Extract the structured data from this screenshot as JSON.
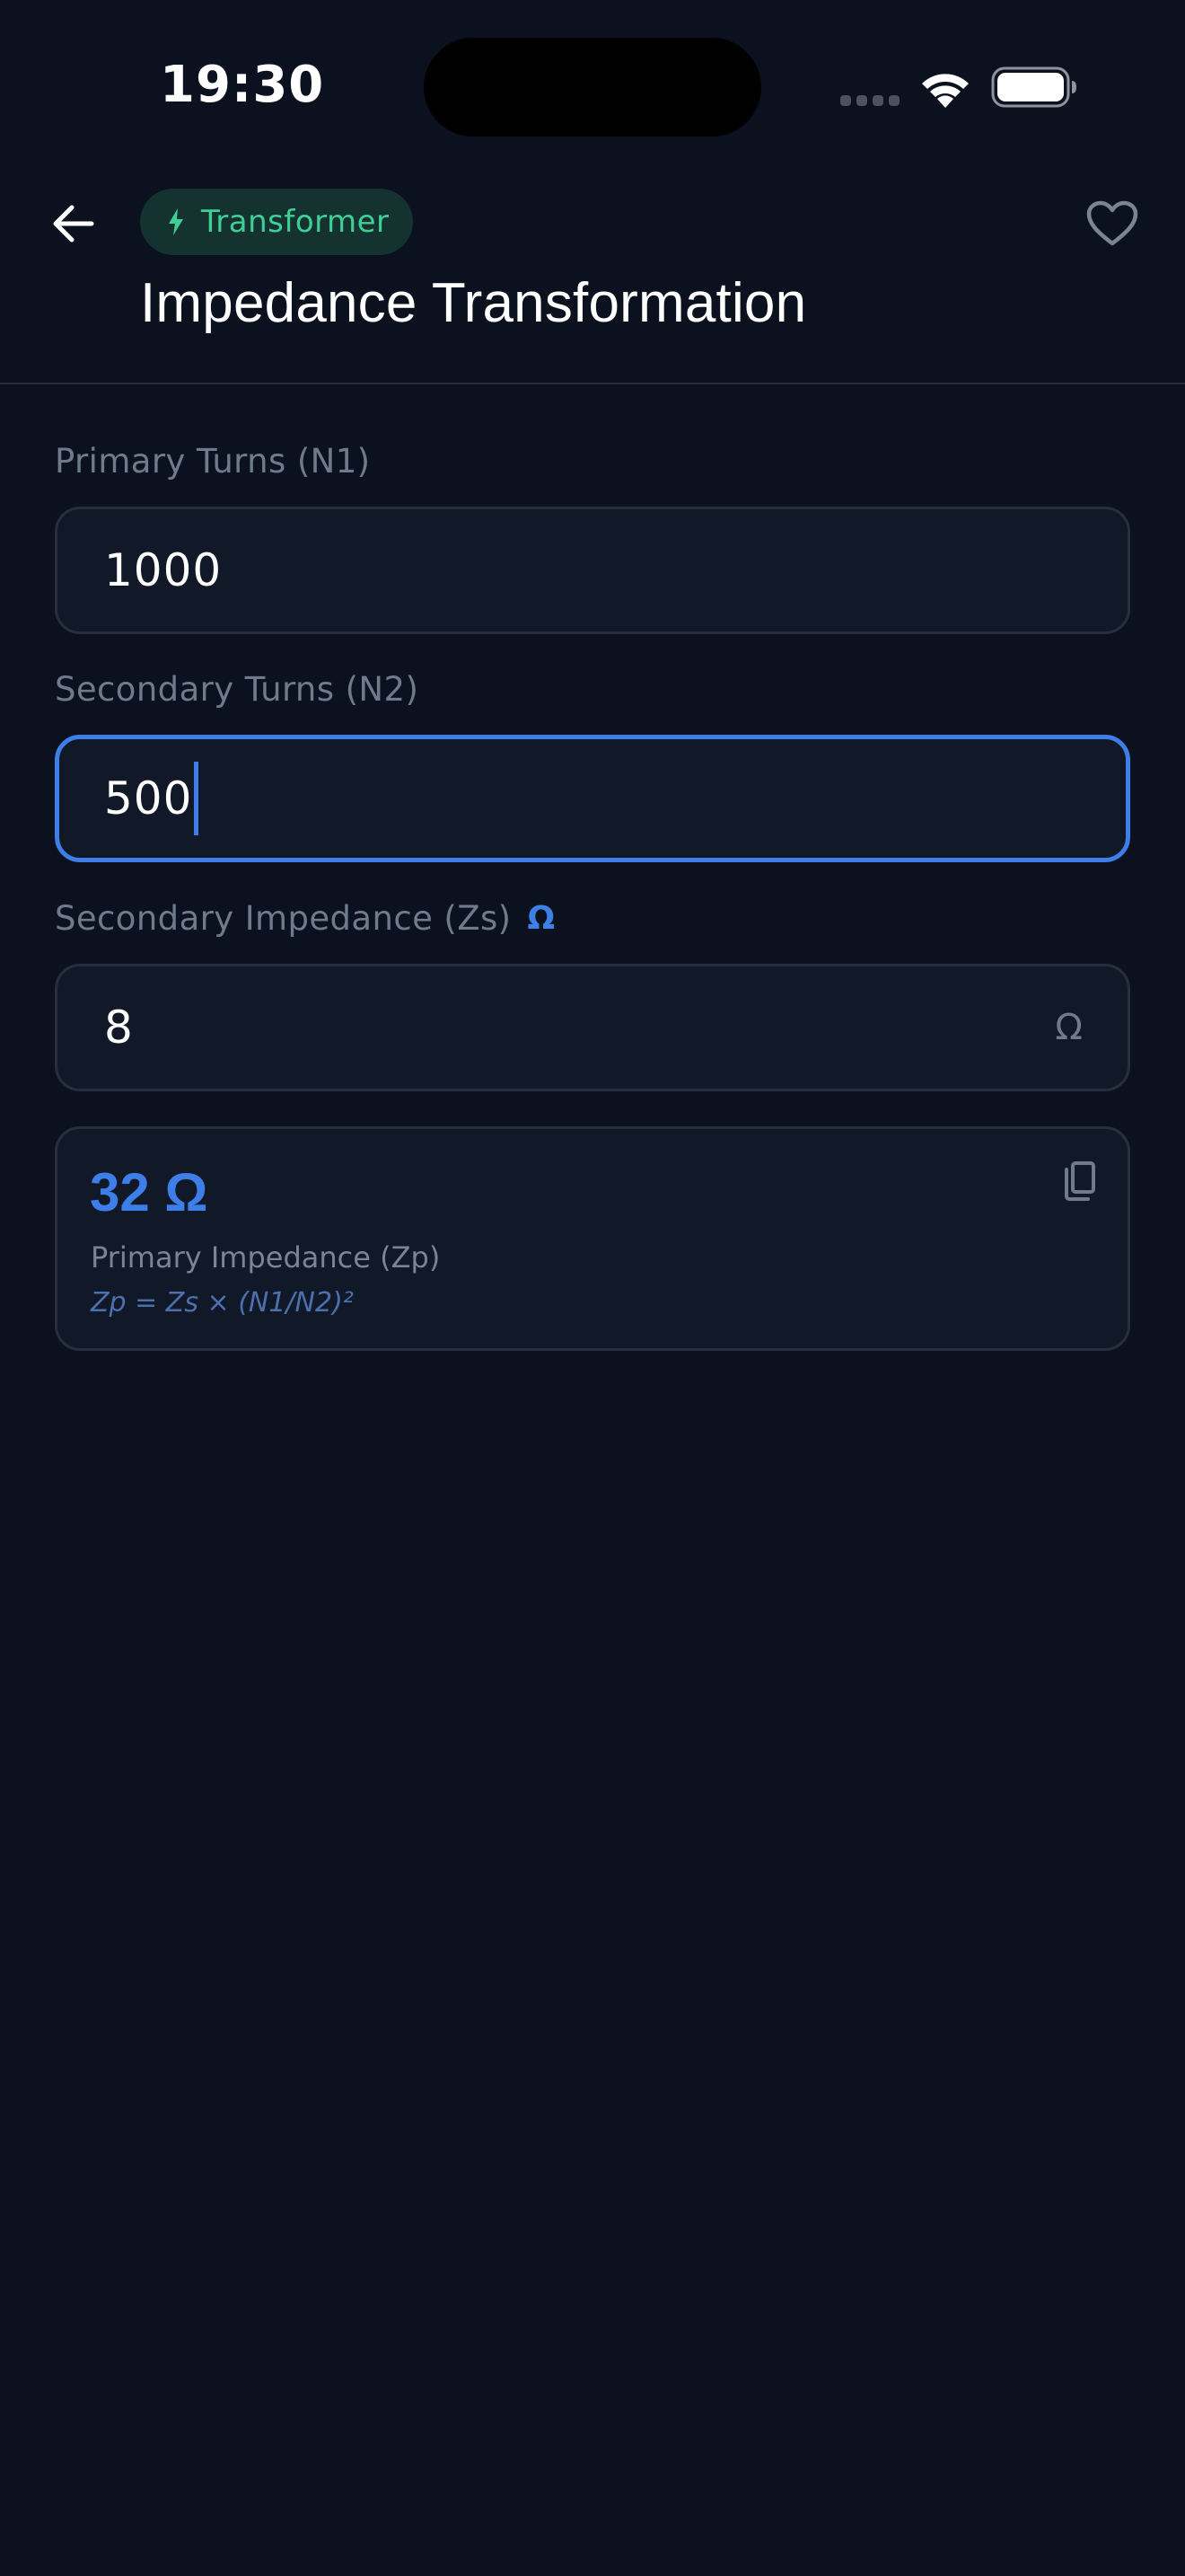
{
  "status_bar": {
    "time": "19:30"
  },
  "header": {
    "category_chip": "Transformer",
    "title": "Impedance Transformation"
  },
  "form": {
    "primary_turns": {
      "label": "Primary Turns (N1)",
      "value": "1000"
    },
    "secondary_turns": {
      "label": "Secondary Turns (N2)",
      "value": "500"
    },
    "secondary_impedance": {
      "label": "Secondary Impedance (Zs)",
      "unit": "Ω",
      "value": "8",
      "suffix": "Ω"
    }
  },
  "result": {
    "value": "32 Ω",
    "label": "Primary Impedance (Zp)",
    "formula": "Zp = Zs × (N1/N2)²"
  },
  "colors": {
    "background": "#0c1120",
    "accent": "#3d7ee8",
    "chip_text": "#3fcf96",
    "chip_background": "#14322f",
    "muted_text": "#6f7a8c"
  },
  "icons": {
    "back": "arrow-left-icon",
    "chip": "lightning-bolt-icon",
    "favorite": "heart-outline-icon",
    "copy": "copy-icon"
  }
}
